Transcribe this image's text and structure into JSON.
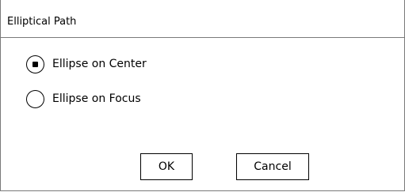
{
  "dialog": {
    "title": "Elliptical Path",
    "options": [
      {
        "label": "Ellipse on Center",
        "selected": true
      },
      {
        "label": "Ellipse on Focus",
        "selected": false
      }
    ],
    "buttons": {
      "ok_label": "OK",
      "cancel_label": "Cancel"
    }
  },
  "colors": {
    "border": "#7a7a7a",
    "background": "#ffffff",
    "text": "#000000"
  },
  "icons": {
    "selected_radio": "radio-selected-icon",
    "unselected_radio": "radio-unselected-icon"
  }
}
